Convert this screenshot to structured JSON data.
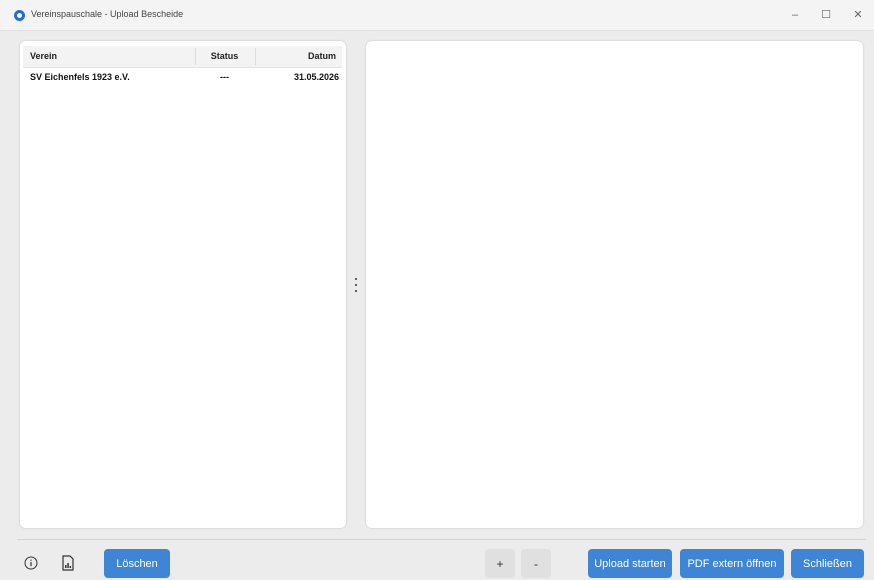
{
  "window": {
    "title": "Vereinspauschale - Upload Bescheide",
    "minimize_glyph": "–",
    "maximize_glyph": "☐",
    "close_glyph": "✕"
  },
  "table": {
    "columns": {
      "verein": "Verein",
      "status": "Status",
      "datum": "Datum"
    },
    "rows": [
      {
        "verein": "SV Eichenfels 1923 e.V.",
        "status": "---",
        "datum": "31.05.2026"
      }
    ]
  },
  "buttons": {
    "delete": "Löschen",
    "plus": "+",
    "minus": "-",
    "upload": "Upload starten",
    "pdf_external": "PDF extern öffnen",
    "close": "Schließen"
  },
  "icons": {
    "info": "info-icon",
    "report": "report-icon",
    "app": "app-icon"
  },
  "colors": {
    "accent": "#3e85d6",
    "app_icon": "#1d6fd8",
    "background": "#ececec",
    "panel": "#ffffff"
  }
}
